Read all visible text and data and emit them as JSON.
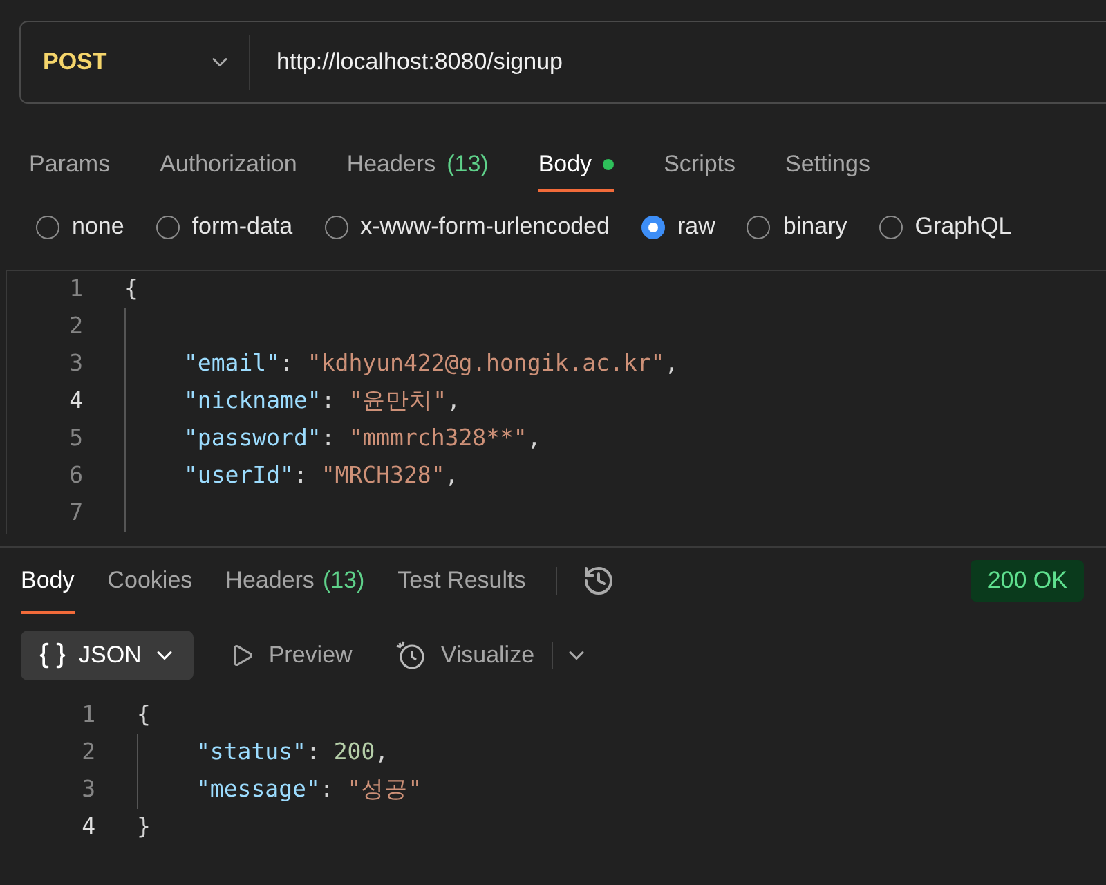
{
  "request": {
    "method": "POST",
    "url": "http://localhost:8080/signup"
  },
  "tabs": [
    {
      "label": "Params",
      "selected": false,
      "dot": false
    },
    {
      "label": "Authorization",
      "selected": false,
      "dot": false
    },
    {
      "label": "Headers",
      "count": "(13)",
      "selected": false,
      "dot": false
    },
    {
      "label": "Body",
      "selected": true,
      "dot": true
    },
    {
      "label": "Scripts",
      "selected": false,
      "dot": false
    },
    {
      "label": "Settings",
      "selected": false,
      "dot": false
    }
  ],
  "body_types": [
    {
      "label": "none",
      "selected": false
    },
    {
      "label": "form-data",
      "selected": false
    },
    {
      "label": "x-www-form-urlencoded",
      "selected": false
    },
    {
      "label": "raw",
      "selected": true
    },
    {
      "label": "binary",
      "selected": false
    },
    {
      "label": "GraphQL",
      "selected": false
    }
  ],
  "request_body": [
    {
      "number": "1",
      "current": false,
      "indented": false,
      "tokens": [
        {
          "kind": "punct",
          "text": "{"
        }
      ]
    },
    {
      "number": "2",
      "current": false,
      "indented": true
    },
    {
      "number": "3",
      "current": false,
      "indented": true,
      "tokens": [
        {
          "kind": "key",
          "text": "\"email\""
        },
        {
          "kind": "punct",
          "text": ": "
        },
        {
          "kind": "string",
          "text": "\"kdhyun422@g.hongik.ac.kr\""
        },
        {
          "kind": "punct",
          "text": ","
        }
      ]
    },
    {
      "number": "4",
      "current": true,
      "indented": true,
      "tokens": [
        {
          "kind": "key",
          "text": "\"nickname\""
        },
        {
          "kind": "punct",
          "text": ": "
        },
        {
          "kind": "string",
          "text": "\"윤만치\""
        },
        {
          "kind": "punct",
          "text": ","
        }
      ]
    },
    {
      "number": "5",
      "current": false,
      "indented": true,
      "tokens": [
        {
          "kind": "key",
          "text": "\"password\""
        },
        {
          "kind": "punct",
          "text": ": "
        },
        {
          "kind": "string",
          "text": "\"mmmrch328**\""
        },
        {
          "kind": "punct",
          "text": ","
        }
      ]
    },
    {
      "number": "6",
      "current": false,
      "indented": true,
      "tokens": [
        {
          "kind": "key",
          "text": "\"userId\""
        },
        {
          "kind": "punct",
          "text": ": "
        },
        {
          "kind": "string",
          "text": "\"MRCH328\""
        },
        {
          "kind": "punct",
          "text": ","
        }
      ]
    },
    {
      "number": "7",
      "current": false,
      "indented": true
    }
  ],
  "response": {
    "tabs": [
      {
        "label": "Body",
        "selected": true
      },
      {
        "label": "Cookies",
        "selected": false
      },
      {
        "label": "Headers",
        "count": "(13)",
        "selected": false
      },
      {
        "label": "Test Results",
        "selected": false
      }
    ],
    "status": "200 OK",
    "format": "JSON",
    "preview": "Preview",
    "visualize": "Visualize",
    "body": [
      {
        "number": "1",
        "current": false,
        "indented": false,
        "tokens": [
          {
            "kind": "punct",
            "text": "{"
          }
        ]
      },
      {
        "number": "2",
        "current": false,
        "indented": true,
        "tokens": [
          {
            "kind": "key",
            "text": "\"status\""
          },
          {
            "kind": "punct",
            "text": ": "
          },
          {
            "kind": "number",
            "text": "200"
          },
          {
            "kind": "punct",
            "text": ","
          }
        ]
      },
      {
        "number": "3",
        "current": false,
        "indented": true,
        "tokens": [
          {
            "kind": "key",
            "text": "\"message\""
          },
          {
            "kind": "punct",
            "text": ": "
          },
          {
            "kind": "string",
            "text": "\"성공\""
          }
        ]
      },
      {
        "number": "4",
        "current": true,
        "indented": false,
        "tokens": [
          {
            "kind": "punct",
            "text": "}"
          }
        ]
      }
    ]
  }
}
